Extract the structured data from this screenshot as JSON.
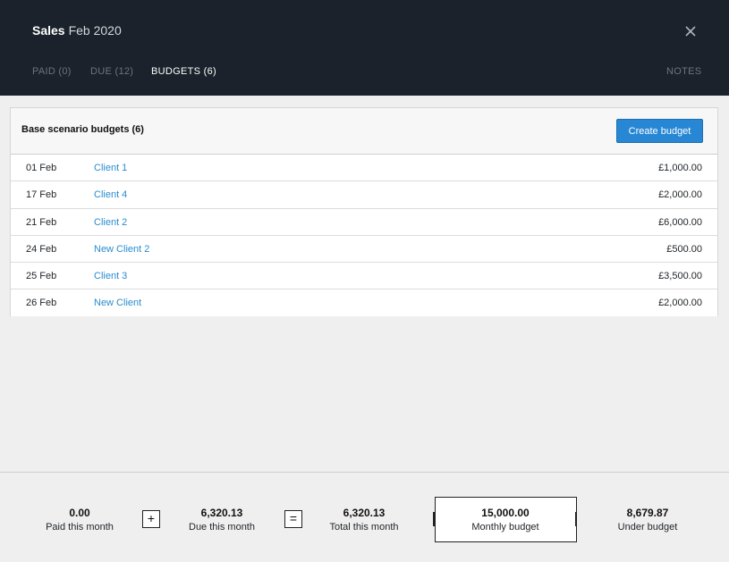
{
  "header": {
    "title_strong": "Sales",
    "title_light": "Feb 2020",
    "tabs": [
      {
        "label": "PAID (0)",
        "active": false
      },
      {
        "label": "DUE (12)",
        "active": false
      },
      {
        "label": "BUDGETS (6)",
        "active": true
      }
    ],
    "notes_label": "NOTES",
    "close_icon": "close-icon"
  },
  "panel": {
    "title": "Base scenario budgets (6)",
    "create_label": "Create budget",
    "rows": [
      {
        "date": "01 Feb",
        "client": "Client 1",
        "amount": "£1,000.00"
      },
      {
        "date": "17 Feb",
        "client": "Client 4",
        "amount": "£2,000.00"
      },
      {
        "date": "21 Feb",
        "client": "Client 2",
        "amount": "£6,000.00"
      },
      {
        "date": "24 Feb",
        "client": "New Client 2",
        "amount": "£500.00"
      },
      {
        "date": "25 Feb",
        "client": "Client 3",
        "amount": "£3,500.00"
      },
      {
        "date": "26 Feb",
        "client": "New Client",
        "amount": "£2,000.00"
      }
    ]
  },
  "footer": {
    "paid": {
      "value": "0.00",
      "label": "Paid this month"
    },
    "plus_symbol": "+",
    "due": {
      "value": "6,320.13",
      "label": "Due this month"
    },
    "equals_symbol": "=",
    "total": {
      "value": "6,320.13",
      "label": "Total this month"
    },
    "budget": {
      "value": "15,000.00",
      "label": "Monthly budget"
    },
    "under": {
      "value": "8,679.87",
      "label": "Under budget"
    }
  },
  "colors": {
    "header_bg": "#1b222b",
    "accent_blue": "#2787d4",
    "link_blue": "#2a8ccf",
    "page_bg": "#efefef"
  }
}
